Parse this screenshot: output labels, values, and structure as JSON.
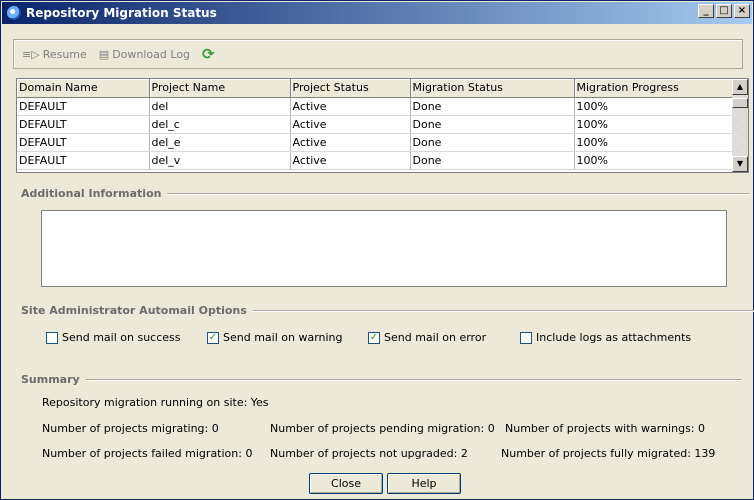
{
  "window": {
    "title": "Repository Migration Status",
    "controls": [
      "_",
      "□",
      "×"
    ]
  },
  "toolbar": {
    "resume": "Resume",
    "download_log": "Download Log"
  },
  "table": {
    "columns": [
      "Domain Name",
      "Project Name",
      "Project Status",
      "Migration Status",
      "Migration Progress"
    ],
    "rows": [
      [
        "DEFAULT",
        "del",
        "Active",
        "Done",
        "100%"
      ],
      [
        "DEFAULT",
        "del_c",
        "Active",
        "Done",
        "100%"
      ],
      [
        "DEFAULT",
        "del_e",
        "Active",
        "Done",
        "100%"
      ],
      [
        "DEFAULT",
        "del_v",
        "Active",
        "Done",
        "100%"
      ]
    ]
  },
  "additional_info": {
    "label": "Additional Information",
    "text": ""
  },
  "automail": {
    "label": "Site Administrator Automail Options",
    "options": [
      {
        "label": "Send mail on success",
        "checked": false
      },
      {
        "label": "Send mail on warning",
        "checked": true
      },
      {
        "label": "Send mail on error",
        "checked": true
      },
      {
        "label": "Include logs as attachments",
        "checked": false
      }
    ]
  },
  "summary": {
    "label": "Summary",
    "running": "Repository migration running on site:  Yes",
    "migrating": "Number of projects migrating: 0",
    "pending": "Number of projects pending migration: 0",
    "warnings": "Number of projects with warnings: 0",
    "failed": "Number of projects failed migration: 0",
    "not_upgraded": "Number of projects not upgraded: 2",
    "fully_migrated": "Number of projects fully migrated: 139"
  },
  "buttons": {
    "close": "Close",
    "help": "Help"
  }
}
